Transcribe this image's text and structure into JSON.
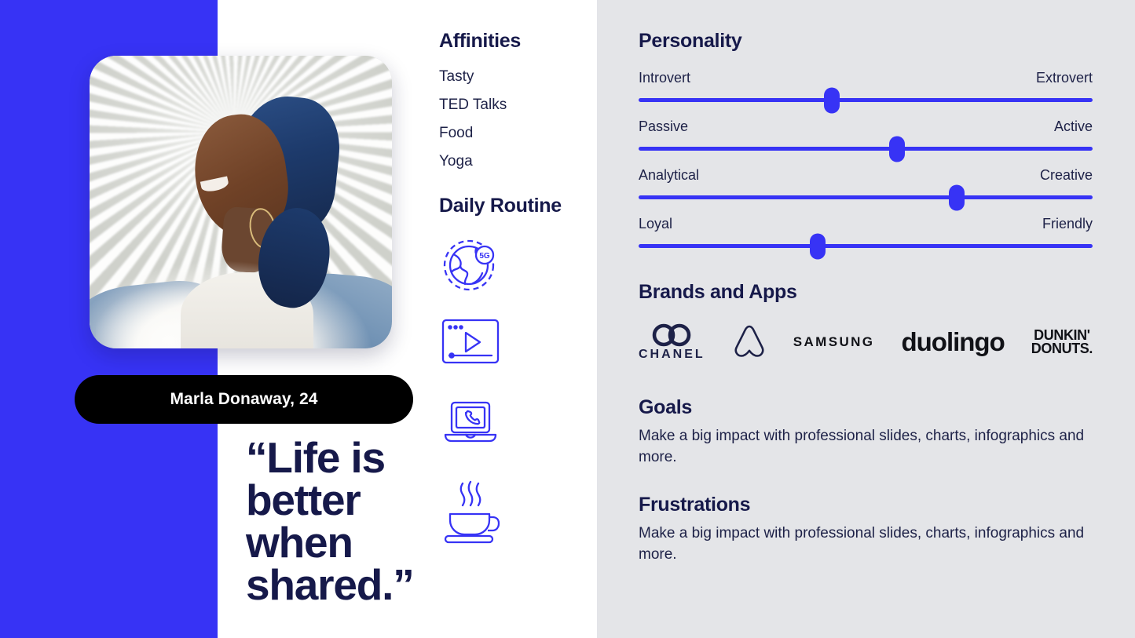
{
  "profile": {
    "name_age": "Marla Donaway, 24",
    "quote": "“Life is better when shared.”",
    "photo_alt": "portrait-of-smiling-woman-with-blue-hair"
  },
  "affinities": {
    "title": "Affinities",
    "items": [
      "Tasty",
      "TED Talks",
      "Food",
      "Yoga"
    ]
  },
  "daily_routine": {
    "title": "Daily Routine",
    "items": [
      {
        "icon": "globe-5g-icon",
        "label": "5G"
      },
      {
        "icon": "video-player-icon",
        "label": ""
      },
      {
        "icon": "laptop-call-icon",
        "label": ""
      },
      {
        "icon": "coffee-cup-icon",
        "label": ""
      }
    ]
  },
  "personality": {
    "title": "Personality",
    "sliders": [
      {
        "left_label": "Introvert",
        "right_label": "Extrovert",
        "value": 42.5
      },
      {
        "left_label": "Passive",
        "right_label": "Active",
        "value": 57.0
      },
      {
        "left_label": "Analytical",
        "right_label": "Creative",
        "value": 70.0
      },
      {
        "left_label": "Loyal",
        "right_label": "Friendly",
        "value": 39.5
      }
    ]
  },
  "brands": {
    "title": "Brands and Apps",
    "items": [
      {
        "name": "Chanel",
        "wordmark": "CHANEL",
        "icon": "chanel-logo"
      },
      {
        "name": "Airbnb",
        "wordmark": "",
        "icon": "airbnb-logo"
      },
      {
        "name": "Samsung",
        "wordmark": "SAMSUNG",
        "icon": "samsung-logo"
      },
      {
        "name": "Duolingo",
        "wordmark": "duolingo",
        "icon": "duolingo-logo"
      },
      {
        "name": "Dunkin' Donuts",
        "wordmark_line1": "DUNKIN'",
        "wordmark_line2": "DONUTS.",
        "icon": "dunkin-donuts-logo"
      }
    ]
  },
  "goals": {
    "title": "Goals",
    "body": "Make a big impact with professional slides, charts, infographics and more."
  },
  "frustrations": {
    "title": "Frustrations",
    "body": "Make a big impact with professional slides, charts, infographics and more."
  },
  "colors": {
    "accent_blue": "#3733f5",
    "dark_navy": "#16194a",
    "panel_gray": "#e4e5e8",
    "black": "#000000",
    "white": "#ffffff"
  }
}
